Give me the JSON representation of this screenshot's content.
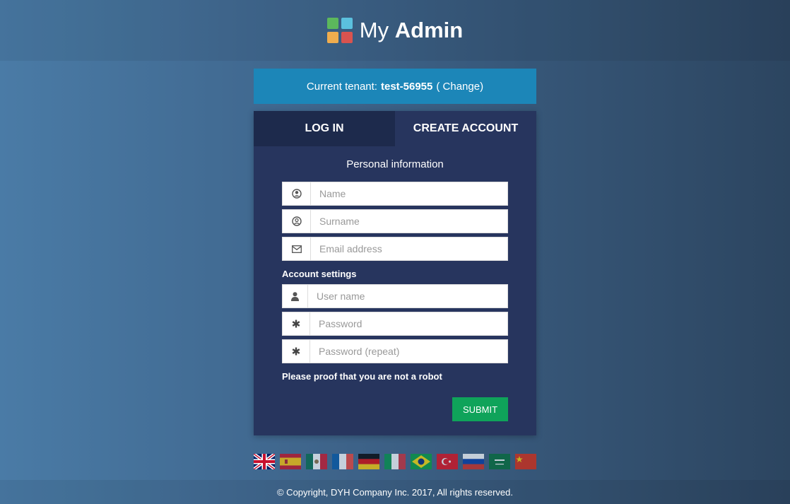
{
  "header": {
    "logo_light": "My",
    "logo_bold": "Admin",
    "logo_colors": [
      "#5cb85c",
      "#5bc0de",
      "#f0ad4e",
      "#d9534f"
    ]
  },
  "tenant": {
    "prefix": "Current tenant:",
    "name": "test-56955",
    "change_label": "( Change)"
  },
  "tabs": [
    {
      "label": "LOG IN"
    },
    {
      "label": "CREATE ACCOUNT"
    }
  ],
  "form": {
    "personal_title": "Personal information",
    "name_placeholder": "Name",
    "surname_placeholder": "Surname",
    "email_placeholder": "Email address",
    "account_title": "Account settings",
    "username_placeholder": "User name",
    "password_placeholder": "Password",
    "password_repeat_placeholder": "Password (repeat)",
    "captcha_label": "Please proof that you are not a robot",
    "submit_label": "SUBMIT"
  },
  "flags": [
    "en",
    "es",
    "mx",
    "fr",
    "de",
    "it",
    "br",
    "tr",
    "ru",
    "sa",
    "cn"
  ],
  "footer": {
    "copyright": "© Copyright, DYH Company Inc. 2017, All rights reserved."
  },
  "colors": {
    "tenant_bar": "#1c86b8",
    "card": "#27355e",
    "active_tab": "#1d2a4c",
    "submit": "#0fa35a"
  }
}
